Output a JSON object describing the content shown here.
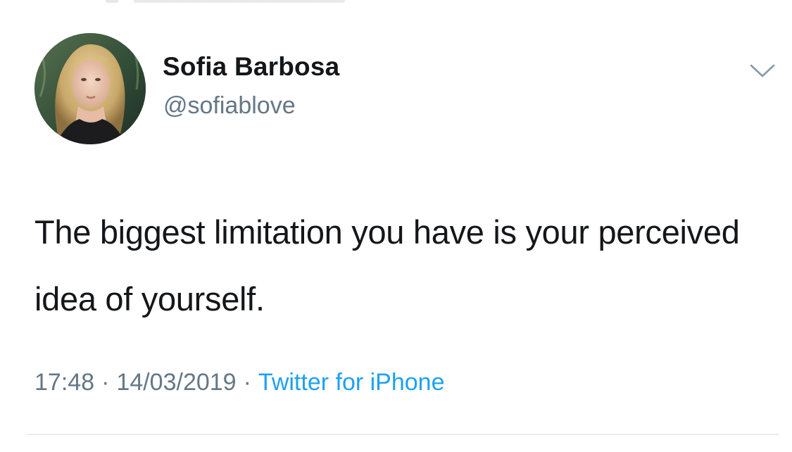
{
  "tweet": {
    "author": {
      "display_name": "Sofia Barbosa",
      "handle": "@sofiablove",
      "avatar_icon": "profile-photo"
    },
    "text": "The biggest limitation you have is your perceived idea of yourself.",
    "time": "17:48",
    "date": "14/03/2019",
    "separator": "·",
    "source": "Twitter for iPhone",
    "menu_icon": "chevron-down-icon"
  },
  "colors": {
    "text_primary": "#14171a",
    "text_secondary": "#657786",
    "link": "#1da1f2",
    "divider": "#e6ecf0",
    "chevron": "#8899a6"
  }
}
